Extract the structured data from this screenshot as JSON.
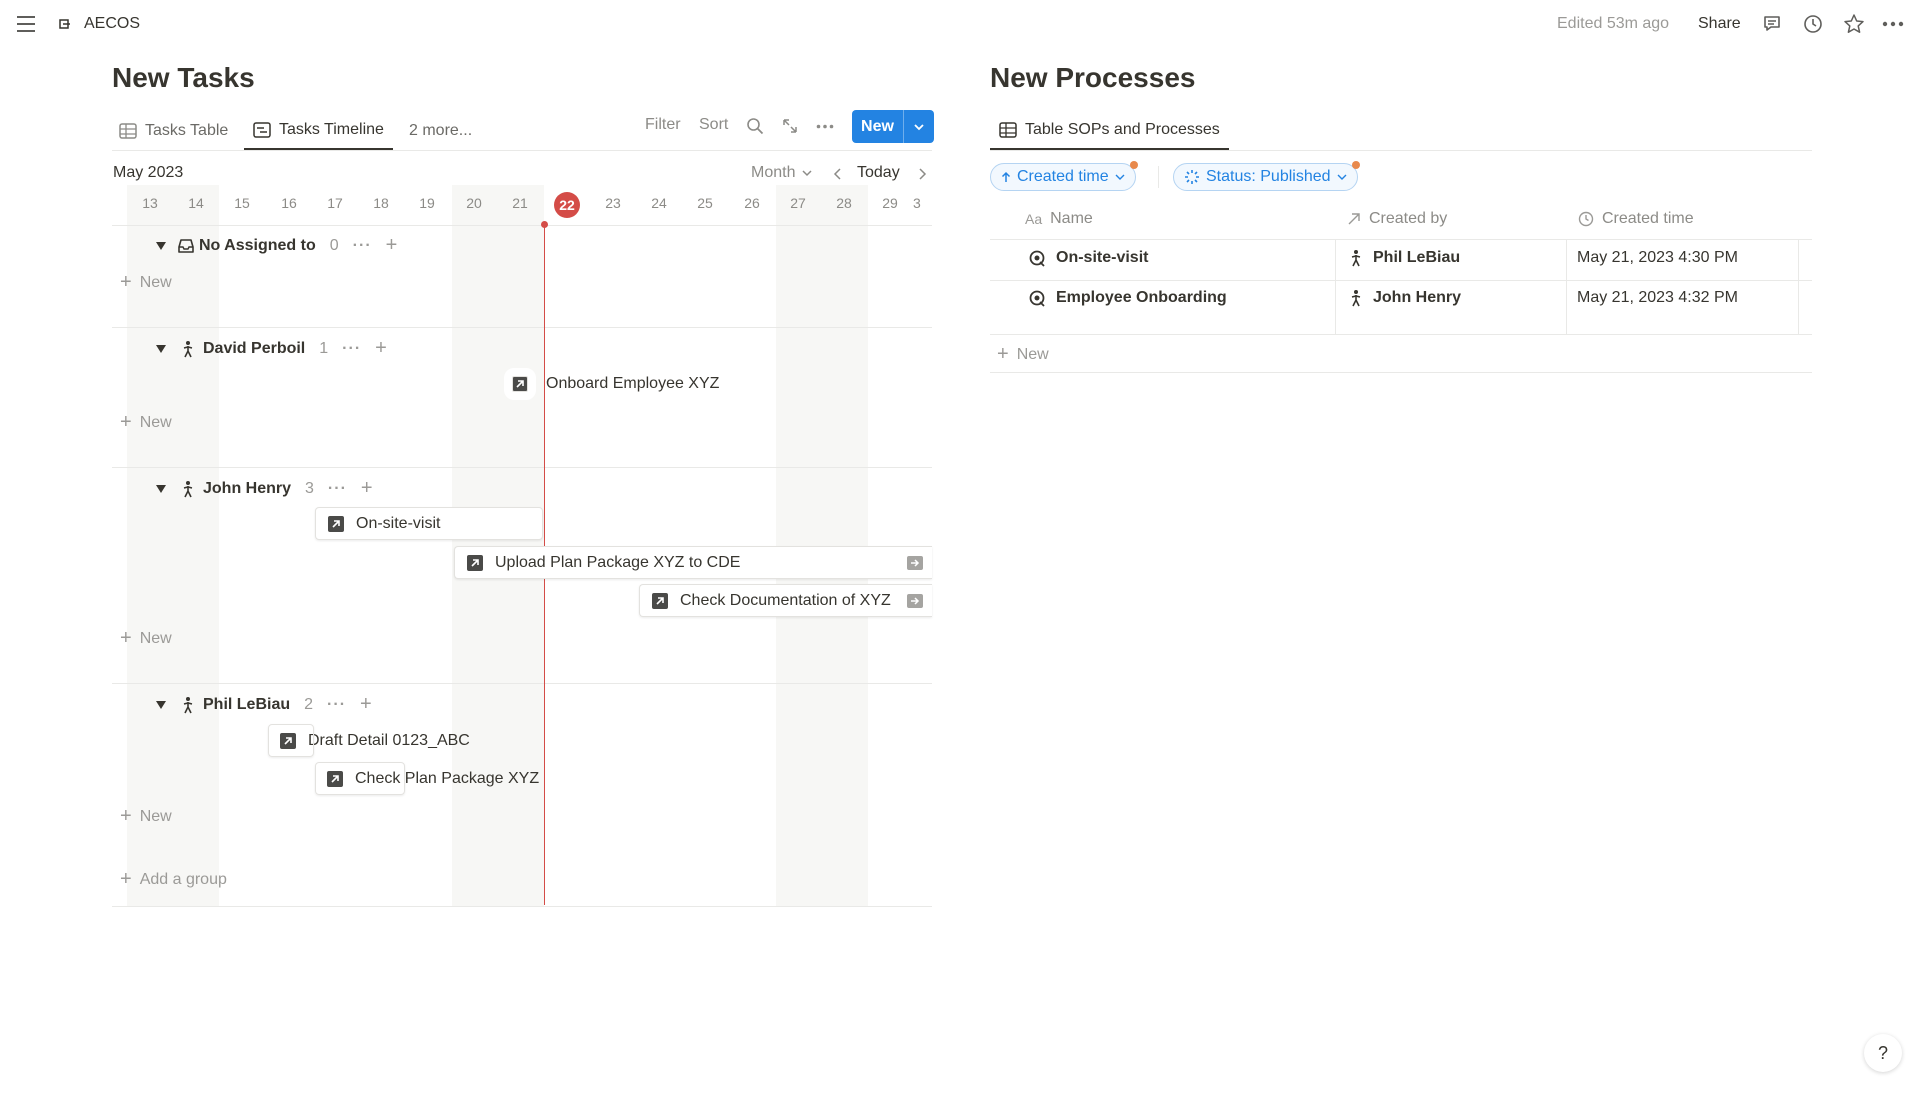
{
  "topbar": {
    "workspace": "AECOS",
    "edited": "Edited 53m ago",
    "share": "Share",
    "icons": [
      "menu-icon",
      "workspace-icon",
      "comment-icon",
      "clock-icon",
      "star-icon",
      "more-icon"
    ]
  },
  "left": {
    "title": "New Tasks",
    "tabs": [
      {
        "label": "Tasks Table",
        "icon": "table-icon"
      },
      {
        "label": "Tasks Timeline",
        "icon": "timeline-icon",
        "active": true
      },
      {
        "label": "2 more..."
      }
    ],
    "toolbar": {
      "filter": "Filter",
      "sort": "Sort",
      "new": "New"
    },
    "timeline": {
      "month": "May 2023",
      "scale": "Month",
      "today": "Today",
      "days": [
        "13",
        "14",
        "15",
        "16",
        "17",
        "18",
        "19",
        "20",
        "21",
        "22",
        "23",
        "24",
        "25",
        "26",
        "27",
        "28",
        "29",
        "3"
      ],
      "current_day": "22",
      "groups": [
        {
          "name": "No Assigned to",
          "count": "0",
          "new": "New",
          "tasks": []
        },
        {
          "name": "David Perboil",
          "count": "1",
          "new": "New",
          "tasks": [
            "Onboard Employee XYZ"
          ]
        },
        {
          "name": "John Henry",
          "count": "3",
          "new": "New",
          "tasks": [
            "On-site-visit",
            "Upload Plan Package XYZ to CDE",
            "Check Documentation of XYZ"
          ]
        },
        {
          "name": "Phil LeBiau",
          "count": "2",
          "new": "New",
          "tasks": [
            "Draft Detail 0123_ABC",
            "Check Plan Package XYZ"
          ]
        }
      ],
      "add_group": "Add a group"
    }
  },
  "right": {
    "title": "New Processes",
    "tab": "Table SOPs and Processes",
    "filters": [
      "Created time",
      "Status: Published"
    ],
    "columns": [
      "Name",
      "Created by",
      "Created time"
    ],
    "rows": [
      {
        "name": "On-site-visit",
        "created_by": "Phil LeBiau",
        "created_time": "May 21, 2023 4:30 PM"
      },
      {
        "name": "Employee Onboarding",
        "created_by": "John Henry",
        "created_time": "May 21, 2023 4:32 PM"
      }
    ],
    "new": "New"
  },
  "help": "?"
}
